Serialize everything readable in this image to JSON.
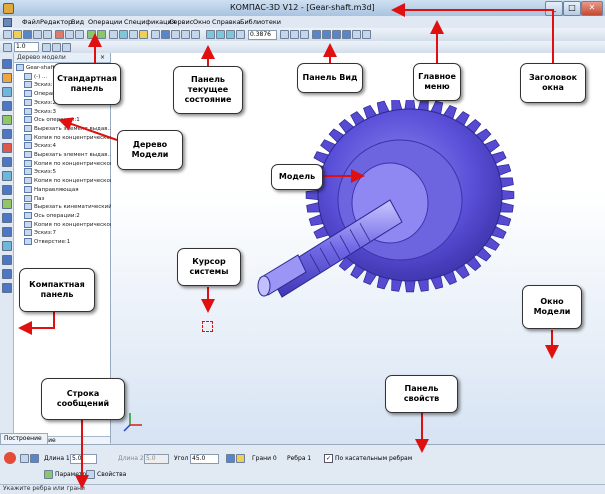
{
  "window": {
    "title": "КОМПАС-3D V12 - [Gear-shaft.m3d]",
    "buttons": [
      "_",
      "□",
      "✕"
    ]
  },
  "menu": {
    "items": [
      "Файл",
      "Редактор",
      "Вид",
      "Операции",
      "Спецификация",
      "Сервис",
      "Окно",
      "Справка",
      "Библиотеки"
    ]
  },
  "toolbar": {
    "scale_value": "0.3876",
    "layer_value": "1.0"
  },
  "tree": {
    "title": "Дерево модели",
    "items": [
      "Gear-shaft",
      "(-) ...",
      "Эскиз:1",
      "Операция вращения:1",
      "Эскиз:2",
      "Эскиз:3",
      "Ось операции:1",
      "Вырезать элемент выдав...",
      "Копия по концентрической...",
      "Эскиз:4",
      "Вырезать элемент выдав...",
      "Копия по концентрической...",
      "Эскиз:5",
      "Копия по концентрической...",
      "Направляющая",
      "Паз",
      "Вырезать кинематический...",
      "Ось операции:2",
      "Копия по концентрической...",
      "Эскиз:7",
      "Отверстие:1"
    ],
    "tab_label": "Построение"
  },
  "properties": {
    "tab_label": "Построение",
    "length_label": "Длина 1",
    "length_value": "5.0",
    "length2_label": "Длина 2",
    "length2_value": "5.0",
    "angle_label": "Угол",
    "angle_value": "45.0",
    "faces_label": "Грани 0",
    "edges_label": "Ребра 1",
    "tangent_label": "По касательным ребрам",
    "tab_params": "Параметры",
    "tab_props": "Свойства"
  },
  "status": {
    "text": "Укажите ребра или грани"
  },
  "callouts": {
    "standard_panel": "Стандартная панель",
    "current_state_panel": "Панель текущее состояние",
    "view_panel": "Панель Вид",
    "main_menu": "Главное меню",
    "window_title": "Заголовок окна",
    "model_tree": "Дерево Модели",
    "model": "Модель",
    "system_cursor": "Курсор системы",
    "compact_panel": "Компактная панель",
    "model_window": "Окно Модели",
    "message_line": "Строка сообщений",
    "properties_panel": "Панель свойств"
  },
  "colors": {
    "model": "#5a4fd8",
    "callout_arrow": "#e01010",
    "frame": "#b9cde3"
  }
}
